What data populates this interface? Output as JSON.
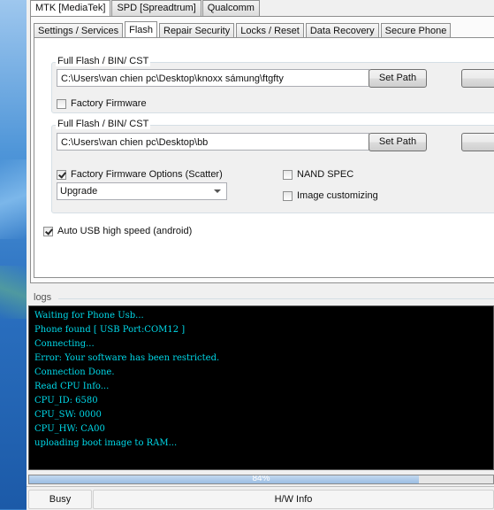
{
  "top_tabs": [
    "MTK [MediaTek]",
    "SPD [Spreadtrum]",
    "Qualcomm"
  ],
  "sub_tabs": [
    "Settings / Services",
    "Flash",
    "Repair Security",
    "Locks / Reset",
    "Data Recovery",
    "Secure Phone"
  ],
  "flash": {
    "group1": {
      "title": "Full Flash / BIN/ CST",
      "path": "C:\\Users\\van chien pc\\Desktop\\knoxx sámung\\ftgfty",
      "set_path_label": "Set Path",
      "factory_firmware_label": "Factory Firmware",
      "factory_firmware_checked": false
    },
    "group2": {
      "title": "Full Flash / BIN/ CST",
      "path": "C:\\Users\\van chien pc\\Desktop\\bb",
      "set_path_label": "Set Path",
      "scatter_label": "Factory Firmware Options (Scatter)",
      "scatter_checked": true,
      "mode_value": "Upgrade",
      "nand_spec_label": "NAND SPEC",
      "image_customizing_label": "Image customizing"
    },
    "auto_usb_label": "Auto USB high speed (android)",
    "auto_usb_checked": true
  },
  "logs": {
    "title": "logs",
    "lines": [
      "Waiting for Phone Usb...",
      "Phone found [ USB Port:COM12 ]",
      "Connecting...",
      "Error: Your software has been restricted.",
      "Connection Done.",
      "Read CPU Info...",
      "CPU_ID: 6580",
      "CPU_SW: 0000",
      "CPU_HW: CA00",
      "uploading boot image to RAM..."
    ],
    "text_color": "#00d8e8"
  },
  "progress": {
    "value": 84,
    "label": "84%"
  },
  "status": {
    "state": "Busy",
    "hw_info": "H/W Info"
  }
}
